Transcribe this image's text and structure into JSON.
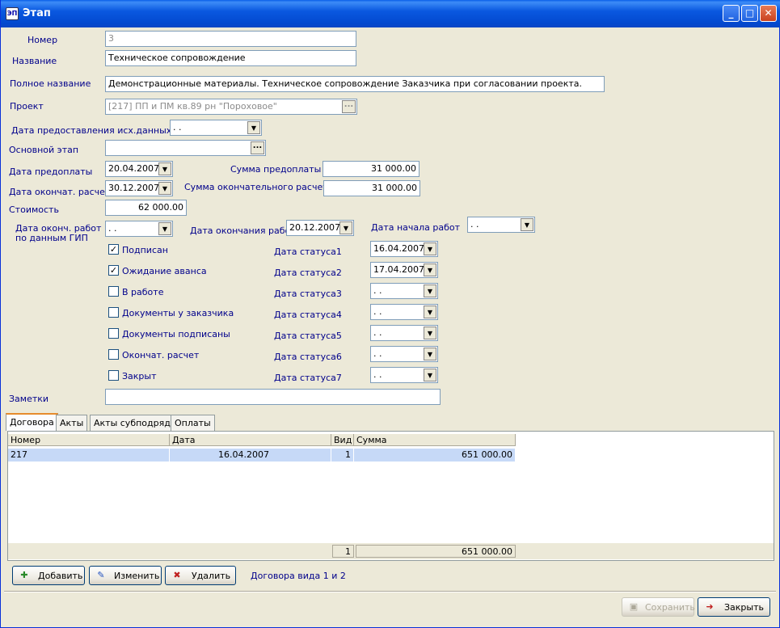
{
  "window": {
    "title": "Этап",
    "min_glyph": "_",
    "max_glyph": "□",
    "close_glyph": "✕",
    "icon_glyph": "ЭП"
  },
  "fields": {
    "number": {
      "label": "Номер",
      "value": "3"
    },
    "name": {
      "label": "Название",
      "value": "Техническое сопровождение"
    },
    "full_name": {
      "label": "Полное название",
      "value": "Демонстрационные материалы. Техническое сопровождение Заказчика при согласовании проекта."
    },
    "project": {
      "label": "Проект",
      "value": "[217] ПП и ПМ кв.89 рн \"Пороховое\""
    },
    "source_data_date": {
      "label": "Дата предоставления исх.данных",
      "value": " .  ."
    },
    "main_stage": {
      "label": "Основной этап",
      "value": ""
    },
    "prepay_date": {
      "label": "Дата предоплаты",
      "value": "20.04.2007"
    },
    "prepay_sum": {
      "label": "Сумма предоплаты",
      "value": "31 000.00"
    },
    "final_calc_date": {
      "label": "Дата окончат. расчета",
      "value": "30.12.2007"
    },
    "final_calc_sum": {
      "label": "Сумма окончательного расчета",
      "value": "31 000.00"
    },
    "cost": {
      "label": "Стоимость",
      "value": "62 000.00"
    },
    "gip_end_date": {
      "label_line1": "Дата оконч. работ",
      "label_line2": "по данным ГИП",
      "value": " .  ."
    },
    "work_end_date": {
      "label": "Дата окончания работ",
      "value": "20.12.2007"
    },
    "work_start_date": {
      "label": "Дата начала работ",
      "value": " .  ."
    },
    "notes": {
      "label": "Заметки",
      "value": ""
    }
  },
  "statuses": [
    {
      "label": "Подписан",
      "checked": true,
      "date_label": "Дата статуса1",
      "date": "16.04.2007",
      "mark": "✓"
    },
    {
      "label": "Ожидание аванса",
      "checked": true,
      "date_label": "Дата статуса2",
      "date": "17.04.2007",
      "mark": "✓"
    },
    {
      "label": "В работе",
      "checked": false,
      "date_label": "Дата статуса3",
      "date": " .  .",
      "mark": ""
    },
    {
      "label": "Документы у заказчика",
      "checked": false,
      "date_label": "Дата статуса4",
      "date": " .  .",
      "mark": ""
    },
    {
      "label": "Документы подписаны",
      "checked": false,
      "date_label": "Дата статуса5",
      "date": " .  .",
      "mark": ""
    },
    {
      "label": "Окончат. расчет",
      "checked": false,
      "date_label": "Дата статуса6",
      "date": " .  .",
      "mark": ""
    },
    {
      "label": "Закрыт",
      "checked": false,
      "date_label": "Дата статуса7",
      "date": " .  .",
      "mark": ""
    }
  ],
  "tabs": [
    {
      "label": "Договора",
      "active": true
    },
    {
      "label": "Акты",
      "active": false
    },
    {
      "label": "Акты субподряда",
      "active": false
    },
    {
      "label": "Оплаты",
      "active": false
    }
  ],
  "grid": {
    "columns": [
      "Номер",
      "Дата",
      "Вид",
      "Сумма"
    ],
    "rows": [
      [
        "217",
        "16.04.2007",
        "1",
        "651 000.00"
      ]
    ],
    "footer": {
      "count": "1",
      "total": "651 000.00"
    }
  },
  "toolbar": {
    "add": "Добавить",
    "edit": "Изменить",
    "delete": "Удалить",
    "info": "Договора вида 1 и 2"
  },
  "dialog": {
    "save": "Сохранить",
    "close": "Закрыть"
  },
  "glyphs": {
    "ellipsis": "...",
    "dropdown": "▼"
  }
}
